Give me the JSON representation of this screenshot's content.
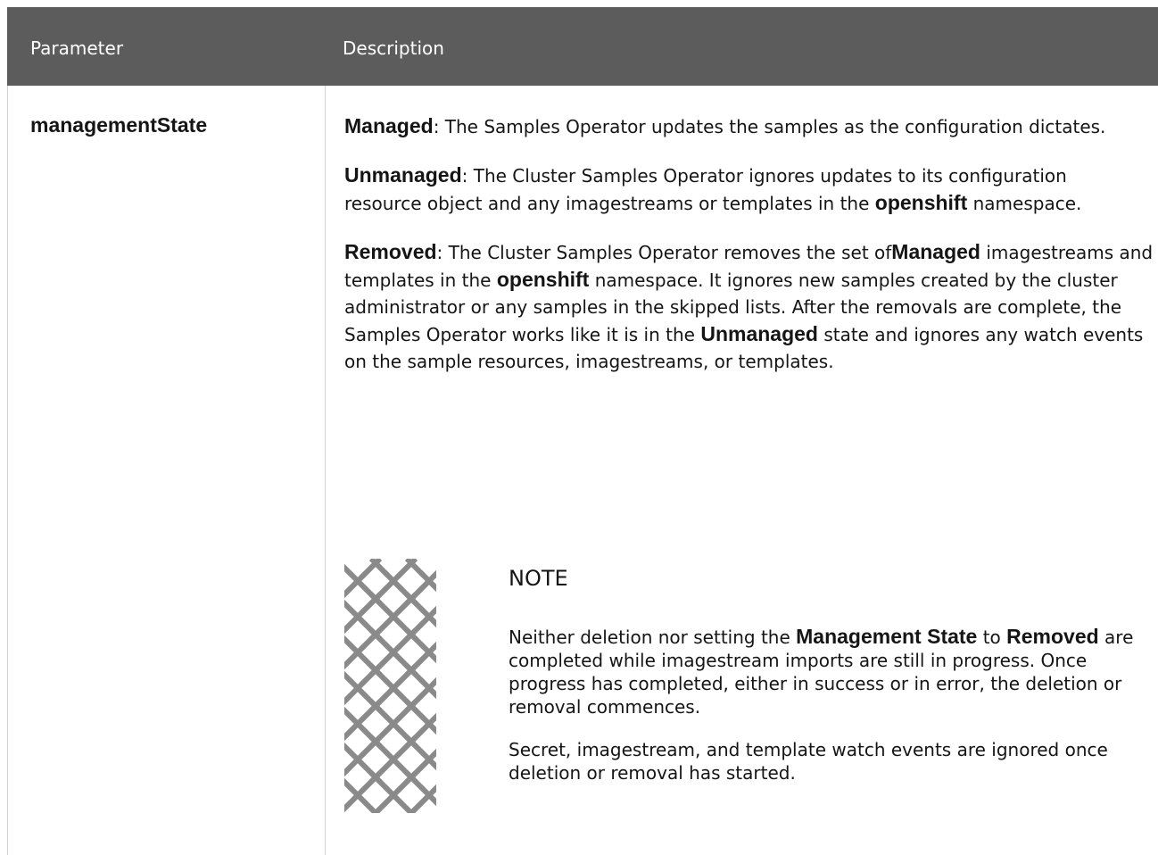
{
  "table": {
    "headers": {
      "parameter": "Parameter",
      "description": "Description"
    },
    "row": {
      "parameter": "managementState",
      "p1": {
        "b1": "Managed",
        "t1": ": The Samples Operator updates the samples as the configuration dictates."
      },
      "p2": {
        "b1": "Unmanaged",
        "t1": ": The Cluster Samples Operator ignores updates to its configuration resource object and any imagestreams or templates in the ",
        "b2": "openshift",
        "t2": " namespace."
      },
      "p3": {
        "b1": "Removed",
        "t1": ": The Cluster Samples Operator removes the set of",
        "b2": "Managed",
        "t2": " imagestreams and templates in the ",
        "b3": "openshift",
        "t3": " namespace. It ignores new samples created by the cluster administrator or any samples in the skipped lists. After the removals are complete, the Samples Operator works like it is in the ",
        "b4": "Unmanaged",
        "t4": " state and ignores any watch events on the sample resources, imagestreams, or templates."
      },
      "note": {
        "icon": "note-pattern-icon",
        "title": "NOTE",
        "n1": {
          "t1": "Neither deletion nor setting the ",
          "b1": "Management State",
          "t2": " to ",
          "b2": "Removed",
          "t3": " are completed while imagestream imports are still in progress. Once progress has completed, either in success or in error, the deletion or removal commences."
        },
        "n2": "Secret, imagestream, and template watch events are ignored once deletion or removal has started."
      }
    }
  },
  "colors": {
    "header_bg": "#5c5c5c",
    "header_text": "#ffffff",
    "text": "#151515",
    "border": "#d2d2d2"
  }
}
